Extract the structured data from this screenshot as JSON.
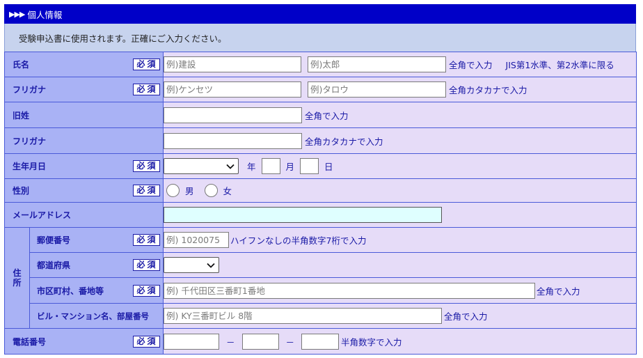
{
  "section": {
    "arrows": "▶▶▶",
    "title": "個人情報"
  },
  "notice": "受験申込書に使用されます。正確にご入力ください。",
  "required_label": "必須",
  "rows": {
    "name": {
      "label": "氏名",
      "last_placeholder": "例)建設",
      "first_placeholder": "例)太郎",
      "note": "全角で入力",
      "note2": "JIS第1水準、第2水準に限る"
    },
    "furigana": {
      "label": "フリガナ",
      "last_placeholder": "例)ケンセツ",
      "first_placeholder": "例)タロウ",
      "note": "全角カタカナで入力"
    },
    "old_surname": {
      "label": "旧姓",
      "note": "全角で入力"
    },
    "old_furigana": {
      "label": "フリガナ",
      "note": "全角カタカナで入力"
    },
    "birthdate": {
      "label": "生年月日",
      "year": "年",
      "month": "月",
      "day": "日"
    },
    "gender": {
      "label": "性別",
      "male": "男",
      "female": "女"
    },
    "email": {
      "label": "メールアドレス"
    },
    "address": {
      "label_char1": "住",
      "label_char2": "所",
      "postal": {
        "label": "郵便番号",
        "placeholder": "例) 1020075",
        "note": "ハイフンなしの半角数字7桁で入力"
      },
      "prefecture": {
        "label": "都道府県"
      },
      "city": {
        "label": "市区町村、番地等",
        "placeholder": "例) 千代田区三番町1番地",
        "note": "全角で入力"
      },
      "building": {
        "label": "ビル・マンション名、部屋番号",
        "placeholder": "例) KY三番町ビル 8階",
        "note": "全角で入力"
      }
    },
    "phone": {
      "label": "電話番号",
      "sep": "－",
      "note": "半角数字で入力"
    }
  }
}
